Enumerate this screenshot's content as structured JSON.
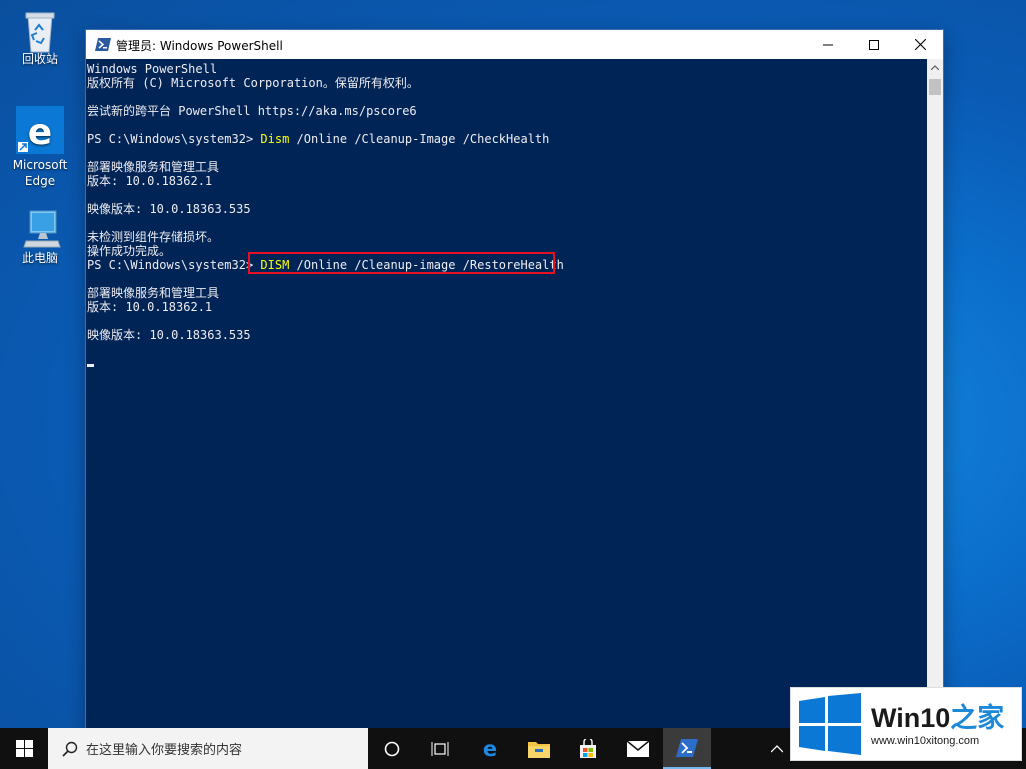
{
  "desktop": {
    "icons": [
      {
        "label": "回收站",
        "icon": "recycle-bin-icon"
      },
      {
        "label": "Microsoft Edge",
        "icon": "edge-icon"
      },
      {
        "label": "此电脑",
        "icon": "this-pc-icon"
      }
    ]
  },
  "window": {
    "title": "管理员: Windows PowerShell",
    "icon": "powershell-icon",
    "controls": [
      "minimize",
      "maximize",
      "close"
    ]
  },
  "console": {
    "lines": [
      {
        "text": "Windows PowerShell"
      },
      {
        "text": "版权所有 (C) Microsoft Corporation。保留所有权利。"
      },
      {
        "text": ""
      },
      {
        "text": "尝试新的跨平台 PowerShell https://aka.ms/pscore6"
      },
      {
        "text": ""
      },
      {
        "prompt": "PS C:\\Windows\\system32> ",
        "cmd": "Dism",
        "args": " /Online /Cleanup-Image /CheckHealth"
      },
      {
        "text": ""
      },
      {
        "text": "部署映像服务和管理工具"
      },
      {
        "text": "版本: 10.0.18362.1"
      },
      {
        "text": ""
      },
      {
        "text": "映像版本: 10.0.18363.535"
      },
      {
        "text": ""
      },
      {
        "text": "未检测到组件存储损坏。"
      },
      {
        "text": "操作成功完成。"
      },
      {
        "prompt": "PS C:\\Windows\\system32> ",
        "cmd": "DISM",
        "args": " /Online /Cleanup-image /RestoreHealth"
      },
      {
        "text": ""
      },
      {
        "text": "部署映像服务和管理工具"
      },
      {
        "text": "版本: 10.0.18362.1"
      },
      {
        "text": ""
      },
      {
        "text": "映像版本: 10.0.18363.535"
      }
    ],
    "highlight_color": "#e81123",
    "background": "#012456",
    "command_color": "#ffff00"
  },
  "taskbar": {
    "search_placeholder": "在这里输入你要搜索的内容",
    "items": [
      "cortana-icon",
      "task-view-icon",
      "edge-icon",
      "file-explorer-icon",
      "store-icon",
      "mail-icon",
      "powershell-icon"
    ],
    "active_item": "powershell-icon"
  },
  "watermark": {
    "brand_main": "Win10",
    "brand_accent": "之家",
    "url": "www.win10xitong.com"
  }
}
